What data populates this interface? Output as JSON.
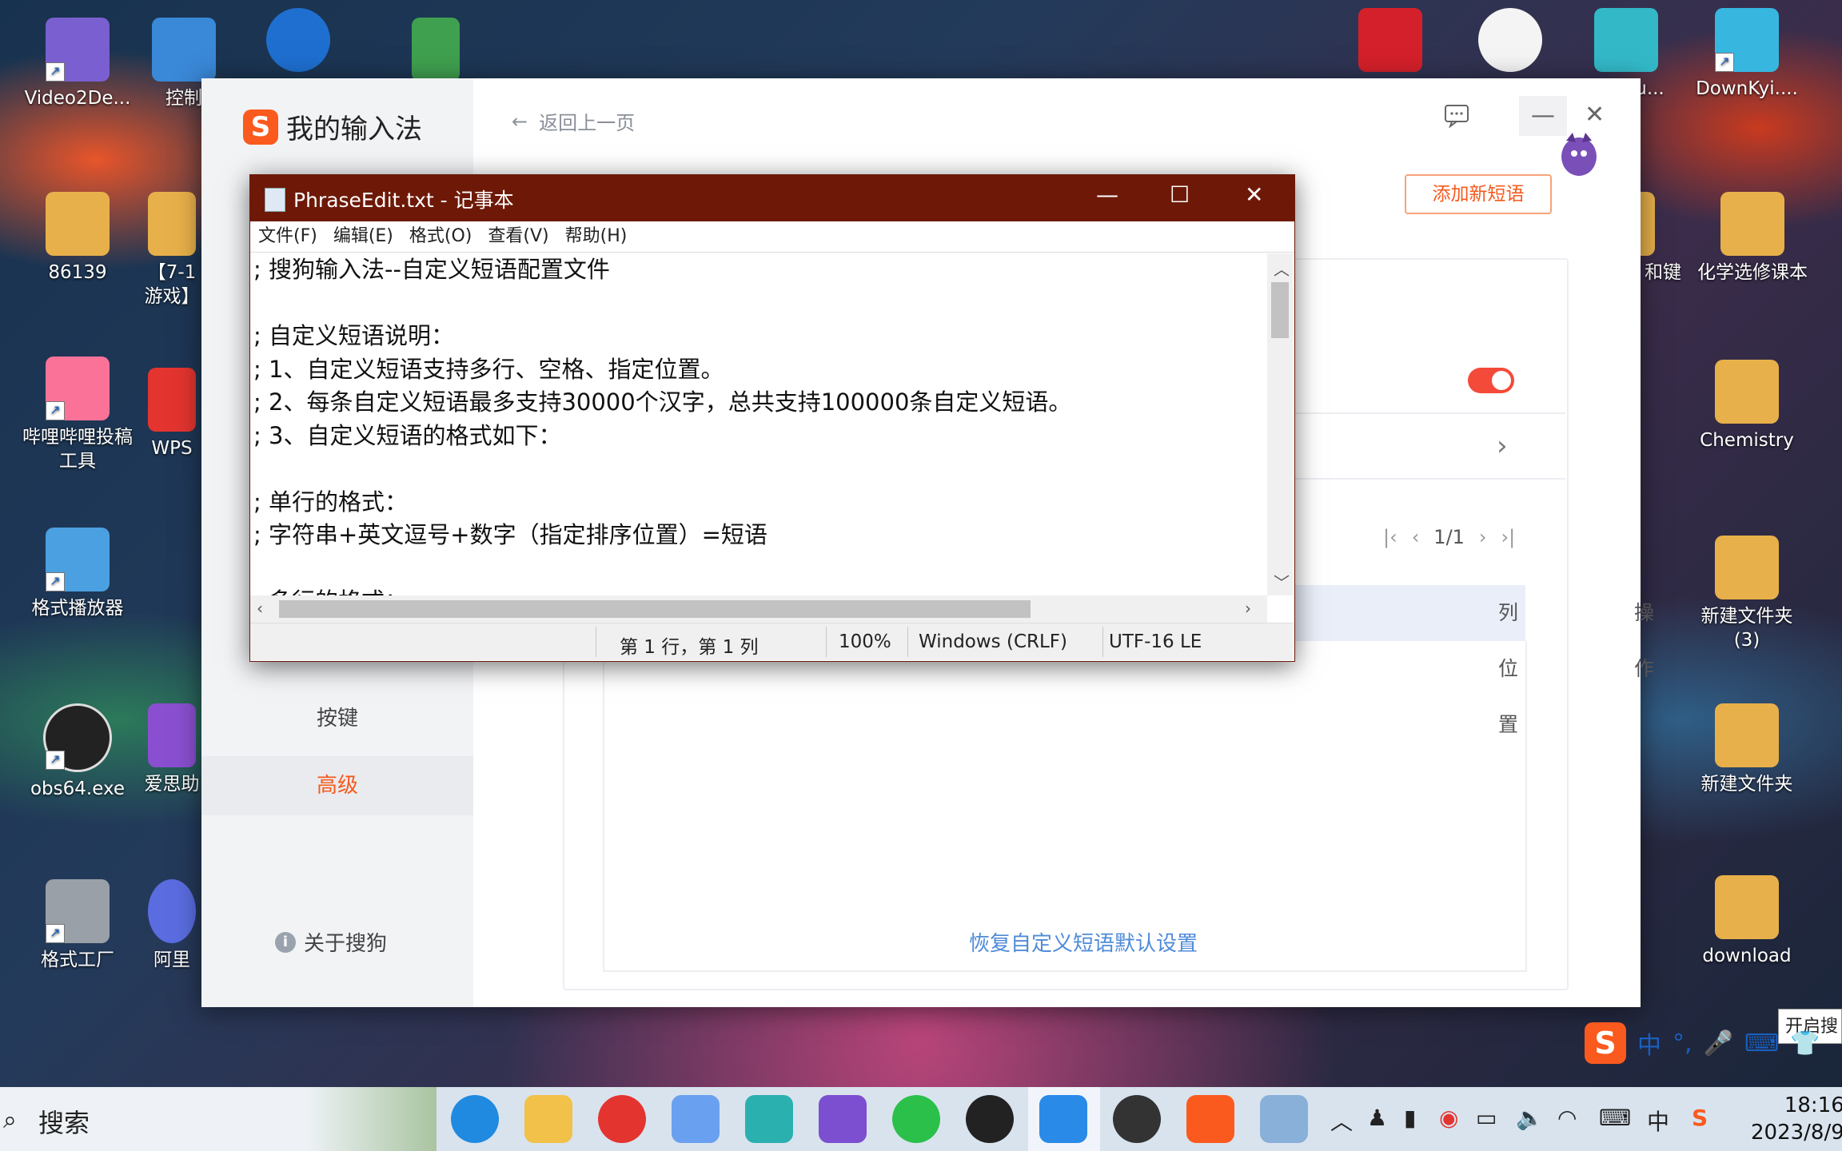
{
  "desktop": {
    "icons": [
      {
        "label": "Video2De...",
        "color": "#7a5fd0"
      },
      {
        "label": "控制",
        "color": "#3a88d8"
      },
      {
        "label": "",
        "color": "#1e6fd0"
      },
      {
        "label": "",
        "color": "#3fa04f"
      },
      {
        "label": "86139",
        "color": "#e8b04a"
      },
      {
        "label": "【7-1",
        "color": "#e8b04a"
      },
      {
        "label": "游戏】",
        "color": "#e8b04a"
      },
      {
        "label": "哔哩哔哩投稿工具",
        "color": "#fb7299"
      },
      {
        "label": "WPS",
        "color": "#e3342f"
      },
      {
        "label": "格式播放器",
        "color": "#4aa0e0"
      },
      {
        "label": "obs64.exe",
        "color": "#222222"
      },
      {
        "label": "爱思助",
        "color": "#8a4fd0"
      },
      {
        "label": "格式工厂",
        "color": "#9aa0a8"
      },
      {
        "label": "阿里",
        "color": "#5a6ce0"
      },
      {
        "label": "",
        "color": "#d4202a"
      },
      {
        "label": "",
        "color": "#f4f4f4"
      },
      {
        "label": "iku...",
        "color": "#33b8c8"
      },
      {
        "label": "DownKyi....",
        "color": "#37b6e0"
      },
      {
        "label": "和键",
        "color": "#e8b04a"
      },
      {
        "label": "化学选修课本",
        "color": "#e8b04a"
      },
      {
        "label": "Chemistry",
        "color": "#e8b04a"
      },
      {
        "label": "新建文件夹 (3)",
        "color": "#e8b04a"
      },
      {
        "label": "新建文件夹",
        "color": "#e8b04a"
      },
      {
        "label": "download",
        "color": "#e8b04a"
      }
    ]
  },
  "sogou": {
    "title": "我的输入法",
    "back_label": "返回上一页",
    "add_button": "添加新短语",
    "nav": [
      {
        "label": "按键"
      },
      {
        "label": "高级"
      }
    ],
    "about": "关于搜狗",
    "pager": {
      "current": "1/1"
    },
    "table_headers": [
      "列位置",
      "操作"
    ],
    "restore_link": "恢复自定义短语默认设置",
    "toggle_on": true,
    "accent_color": "#f55a1e"
  },
  "notepad": {
    "title": "PhraseEdit.txt - 记事本",
    "menu": [
      "文件(F)",
      "编辑(E)",
      "格式(O)",
      "查看(V)",
      "帮助(H)"
    ],
    "lines": [
      "; 搜狗输入法--自定义短语配置文件",
      "",
      "; 自定义短语说明：",
      "; 1、自定义短语支持多行、空格、指定位置。",
      "; 2、每条自定义短语最多支持30000个汉字，总共支持100000条自定义短语。",
      "; 3、自定义短语的格式如下：",
      "",
      "; 单行的格式：",
      "; 字符串+英文逗号+数字（指定排序位置）=短语",
      "",
      "; 多行的格式："
    ],
    "status": {
      "position": "第 1 行，第 1 列",
      "zoom": "100%",
      "line_ending": "Windows (CRLF)",
      "encoding": "UTF-16 LE"
    }
  },
  "taskbar": {
    "search_label": "搜索",
    "apps": [
      {
        "name": "edge",
        "color": "#1f8ae0"
      },
      {
        "name": "file-explorer",
        "color": "#f2c14a"
      },
      {
        "name": "netease-music",
        "color": "#e3342f"
      },
      {
        "name": "app-4",
        "color": "#6aa0f0"
      },
      {
        "name": "app-5",
        "color": "#2bb0b0"
      },
      {
        "name": "visual-studio",
        "color": "#7b4fd0"
      },
      {
        "name": "wechat",
        "color": "#2bc04a"
      },
      {
        "name": "qq",
        "color": "#222222"
      },
      {
        "name": "feishu",
        "color": "#2a8ae8"
      },
      {
        "name": "obs",
        "color": "#333333"
      },
      {
        "name": "sogou",
        "color": "#fb5a1e"
      },
      {
        "name": "notepad",
        "color": "#88b0d8"
      }
    ],
    "ime_lang": "中",
    "time": "18:16",
    "date": "2023/8/9"
  },
  "ime_toolbar": {
    "lang": "中"
  },
  "tooltip": "开启搜"
}
